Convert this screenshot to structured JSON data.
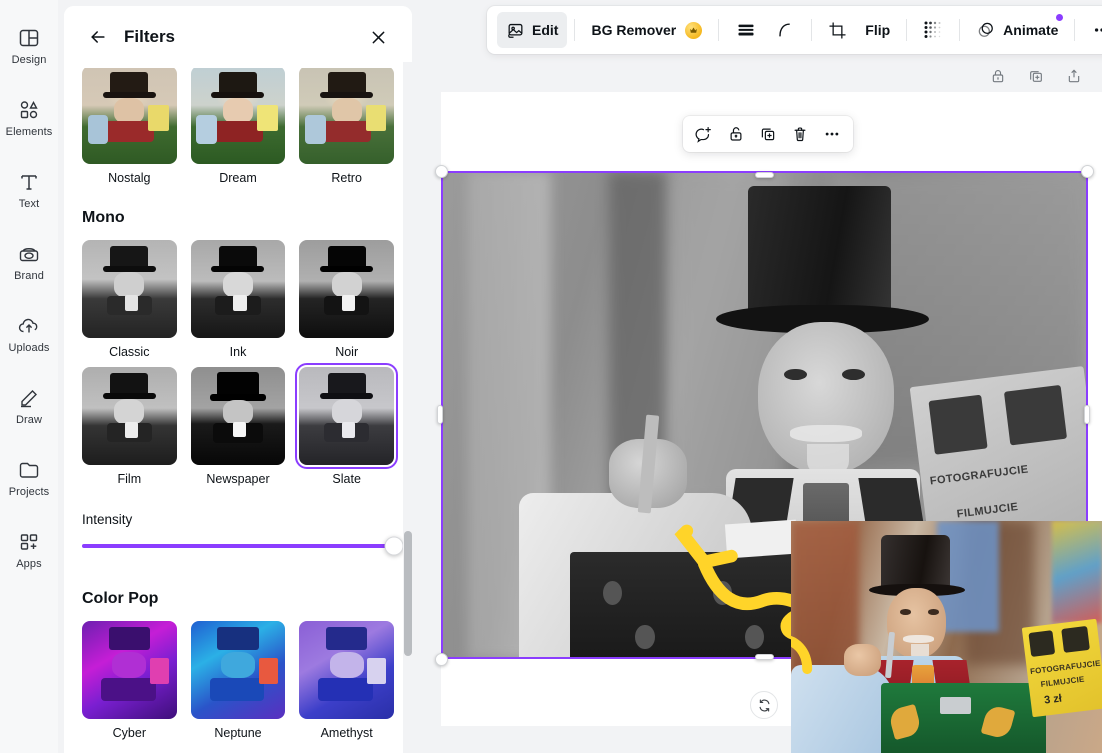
{
  "app": {
    "accent_purple": "#8b3dff",
    "crown_gold": "#f5b820",
    "annotation_yellow": "#ffd429"
  },
  "sidebar": {
    "items": [
      {
        "label": "Design",
        "icon": "design-icon"
      },
      {
        "label": "Elements",
        "icon": "elements-icon"
      },
      {
        "label": "Text",
        "icon": "text-icon"
      },
      {
        "label": "Brand",
        "icon": "brand-icon"
      },
      {
        "label": "Uploads",
        "icon": "uploads-icon"
      },
      {
        "label": "Draw",
        "icon": "draw-icon"
      },
      {
        "label": "Projects",
        "icon": "projects-icon"
      },
      {
        "label": "Apps",
        "icon": "apps-icon"
      }
    ]
  },
  "filters_panel": {
    "title": "Filters",
    "back_icon": "arrow-left-icon",
    "close_icon": "close-icon",
    "top_row": [
      {
        "label": "Nostalg",
        "selected": false
      },
      {
        "label": "Dream",
        "selected": false
      },
      {
        "label": "Retro",
        "selected": false
      }
    ],
    "mono_section": {
      "title": "Mono",
      "items": [
        {
          "label": "Classic",
          "selected": false
        },
        {
          "label": "Ink",
          "selected": false
        },
        {
          "label": "Noir",
          "selected": false
        },
        {
          "label": "Film",
          "selected": false
        },
        {
          "label": "Newspaper",
          "selected": false
        },
        {
          "label": "Slate",
          "selected": true
        }
      ]
    },
    "intensity": {
      "label": "Intensity",
      "value": 100,
      "min": 0,
      "max": 100
    },
    "color_pop_section": {
      "title": "Color Pop",
      "items": [
        {
          "label": "Cyber"
        },
        {
          "label": "Neptune"
        },
        {
          "label": "Amethyst"
        }
      ]
    }
  },
  "toolbar": {
    "edit_label": "Edit",
    "edit_icon": "image-edit-icon",
    "bg_remover_label": "BG Remover",
    "bg_remover_badge_icon": "crown-icon",
    "adjust_icon": "adjust-lines-icon",
    "curve_icon": "curve-icon",
    "crop_icon": "crop-icon",
    "flip_label": "Flip",
    "transparency_icon": "transparency-dots-icon",
    "animate_label": "Animate",
    "animate_icon": "animate-circles-icon",
    "more_icon": "more-horizontal-icon"
  },
  "top_right_icons": [
    {
      "name": "lock-icon"
    },
    {
      "name": "duplicate-icon"
    },
    {
      "name": "share-export-icon"
    }
  ],
  "element_toolbar": [
    {
      "name": "comment-add-icon"
    },
    {
      "name": "unlock-icon"
    },
    {
      "name": "duplicate-icon"
    },
    {
      "name": "delete-icon"
    },
    {
      "name": "more-horizontal-icon"
    }
  ],
  "canvas": {
    "refresh_icon": "refresh-icon",
    "image_alt": "black-and-white photo of elderly man in top hat with barrel organ",
    "sign_text_line1": "FOTOGRAFUJCIE",
    "sign_text_line2": "FILMUJCIE",
    "selection_active": true
  },
  "preview_overlay": {
    "alt": "color original preview of the same photo",
    "sign_text_line1": "FOTOGRAFUJCIE",
    "sign_text_line2": "FILMUJCIE",
    "price_text": "3 zł"
  }
}
